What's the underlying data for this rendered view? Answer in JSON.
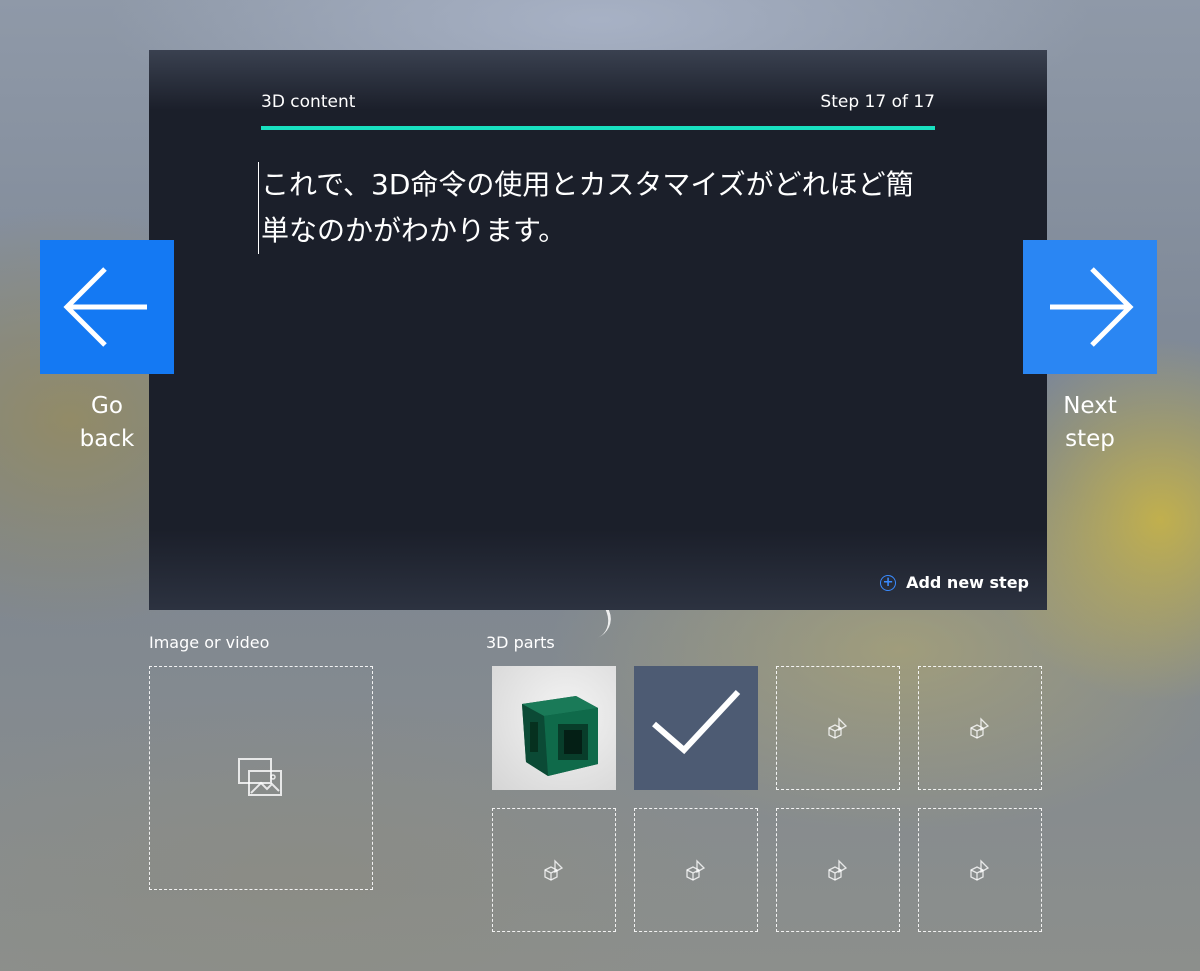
{
  "panel": {
    "section_title": "3D content",
    "step_counter": "Step 17 of 17",
    "progress": 1.0,
    "accent_color": "#19e0c0",
    "instruction_text": "これで、3D命令の使用とカスタマイズがどれほど簡単なのかがわかります。",
    "add_step_label": "Add new step"
  },
  "nav": {
    "back_label_line1": "Go",
    "back_label_line2": "back",
    "next_label_line1": "Next",
    "next_label_line2": "step",
    "button_color": "#1479f3"
  },
  "media": {
    "image_video_label": "Image or video",
    "parts_label": "3D parts",
    "slot_icon": "image-placeholder-icon",
    "part_icon": "3d-shapes-icon",
    "selected_icon": "checkmark-icon"
  }
}
